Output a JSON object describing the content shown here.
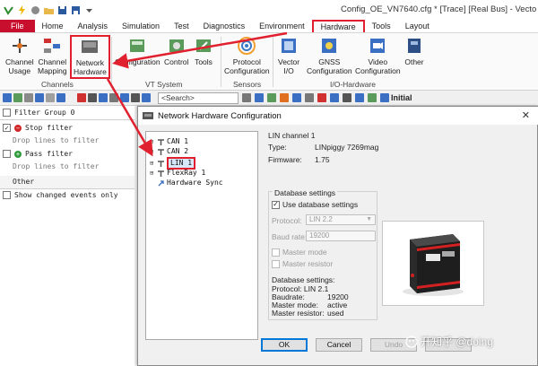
{
  "window": {
    "title": "Config_OE_VN7640.cfg * [Trace] [Real Bus] - Vecto"
  },
  "tabs": [
    {
      "label": "File"
    },
    {
      "label": "Home"
    },
    {
      "label": "Analysis"
    },
    {
      "label": "Simulation"
    },
    {
      "label": "Test"
    },
    {
      "label": "Diagnostics"
    },
    {
      "label": "Environment"
    },
    {
      "label": "Hardware"
    },
    {
      "label": "Tools"
    },
    {
      "label": "Layout"
    }
  ],
  "ribbon": {
    "channels_group": "Channels",
    "vt_group": "VT System",
    "sensors_group": "Sensors",
    "io_group": "I/O-Hardware",
    "buttons": {
      "channel_usage": [
        "Channel",
        "Usage"
      ],
      "channel_mapping": [
        "Channel",
        "Mapping"
      ],
      "network_hardware": [
        "Network",
        "Hardware"
      ],
      "configuration": "Configuration",
      "control": "Control",
      "tools": "Tools",
      "protocol_configuration": [
        "Protocol",
        "Configuration"
      ],
      "vector_io": [
        "Vector",
        "I/O"
      ],
      "gnss_configuration": [
        "GNSS",
        "Configuration"
      ],
      "video_configuration": [
        "Video",
        "Configuration"
      ],
      "other": "Other"
    }
  },
  "toolbar2": {
    "search_placeholder": "<Search>",
    "initial_label": "Initial"
  },
  "filter_panel": {
    "group_header": "Filter Group 0",
    "stop_filter": "Stop filter",
    "stop_hint": "Drop lines to filter",
    "pass_filter": "Pass filter",
    "pass_hint": "Drop lines to filter",
    "other_header": "Other",
    "show_changed": "Show changed events only"
  },
  "dialog": {
    "title": "Network Hardware Configuration",
    "close_glyph": "✕",
    "tree": [
      {
        "label": "CAN 1"
      },
      {
        "label": "CAN 2"
      },
      {
        "label": "LIN 1"
      },
      {
        "label": "FlexRay 1"
      },
      {
        "label": "Hardware Sync"
      }
    ],
    "channel_heading": "LIN channel 1",
    "type_label": "Type:",
    "type_value": "LINpiggy 7269mag",
    "firmware_label": "Firmware:",
    "firmware_value": "1.75",
    "db_group": "Database settings",
    "use_db": "Use database settings",
    "protocol_label": "Protocol:",
    "protocol_value": "LIN 2.2",
    "baud_label": "Baud rate:",
    "baud_value": "19200",
    "master_mode": "Master mode",
    "master_resistor": "Master resistor",
    "db_settings_heading": "Database settings:",
    "db_protocol": "Protocol: LIN 2.1",
    "db_baud_label": "Baudrate:",
    "db_baud_value": "19200",
    "db_mode_label": "Master mode:",
    "db_mode_value": "active",
    "db_res_label": "Master resistor:",
    "db_res_value": "used",
    "buttons": {
      "ok": "OK",
      "cancel": "Cancel",
      "undo": "Undo"
    }
  },
  "watermark": "开知乎 @doing",
  "colors": {
    "accent_red": "#e0202e",
    "file_tab": "#c8102e",
    "primary_button_border": "#0078d7"
  }
}
